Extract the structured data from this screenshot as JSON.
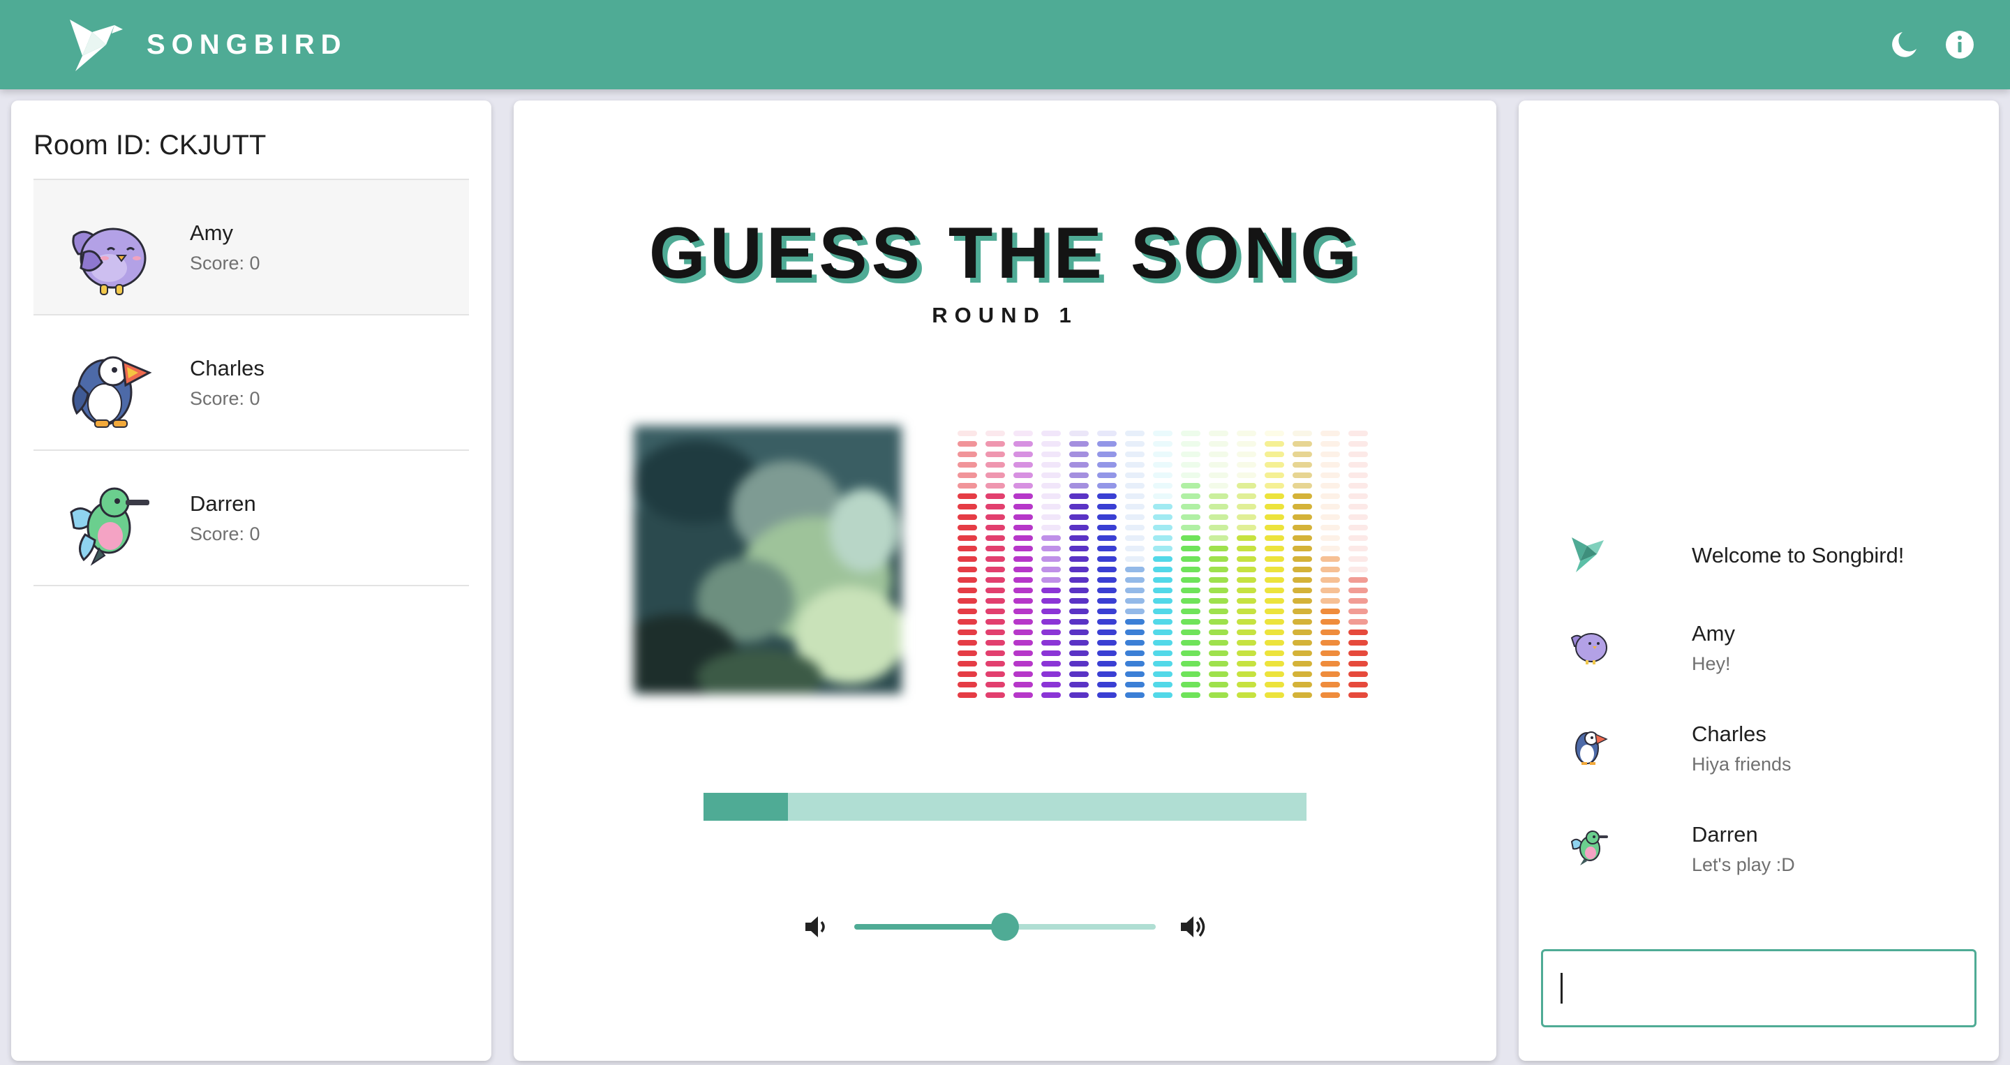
{
  "app": {
    "name": "SONGBIRD",
    "brand_color": "#4fab95",
    "icons": {
      "logo": "origami-bird-icon",
      "theme": "moon-icon",
      "info": "info-icon"
    }
  },
  "room": {
    "title": "Room ID: CKJUTT"
  },
  "players": [
    {
      "name": "Amy",
      "score": "Score: 0",
      "avatar": "purple-bird-icon",
      "active": true
    },
    {
      "name": "Charles",
      "score": "Score: 0",
      "avatar": "puffin-icon",
      "active": false
    },
    {
      "name": "Darren",
      "score": "Score: 0",
      "avatar": "hummingbird-icon",
      "active": false
    }
  ],
  "game": {
    "title": "GUESS THE SONG",
    "round": "ROUND 1",
    "song_progress": 0.14,
    "volume": 0.5,
    "icons": {
      "volume_low": "volume-down-icon",
      "volume_high": "volume-up-icon"
    },
    "visualizer_colors": [
      "#e53c45",
      "#e23f6e",
      "#b637c9",
      "#8b35d6",
      "#5a33c5",
      "#3a3fd3",
      "#3b7fd6",
      "#52d8e8",
      "#6fe35a",
      "#9ee14c",
      "#c6e240",
      "#ece33c",
      "#d4b238",
      "#ef8c3c",
      "#e64a3c"
    ],
    "visualizer_levels": [
      0.95,
      0.95,
      0.95,
      0.62,
      0.95,
      0.95,
      0.5,
      0.72,
      0.8,
      0.78,
      0.8,
      0.95,
      0.95,
      0.55,
      0.45
    ]
  },
  "chat": {
    "messages": [
      {
        "name": "",
        "text": "Welcome to Songbird!",
        "avatar": "origami-bird-icon"
      },
      {
        "name": "Amy",
        "text": "Hey!",
        "avatar": "purple-bird-icon"
      },
      {
        "name": "Charles",
        "text": "Hiya friends",
        "avatar": "puffin-icon"
      },
      {
        "name": "Darren",
        "text": "Let's play :D",
        "avatar": "hummingbird-icon"
      }
    ],
    "input_value": ""
  }
}
